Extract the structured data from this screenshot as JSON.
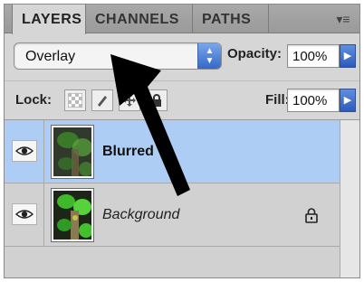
{
  "tabs": [
    {
      "label": "LAYERS",
      "active": true
    },
    {
      "label": "CHANNELS",
      "active": false
    },
    {
      "label": "PATHS",
      "active": false
    }
  ],
  "panel_menu_icon": "panel-menu-icon",
  "blend": {
    "value": "Overlay"
  },
  "opacity": {
    "label": "Opacity:",
    "value": "100%"
  },
  "lock": {
    "label": "Lock:"
  },
  "fill": {
    "label": "Fill:",
    "value": "100%"
  },
  "layers": [
    {
      "name": "Blurred",
      "selected": true,
      "visible": true
    },
    {
      "name": "Background",
      "selected": false,
      "visible": true,
      "locked": true
    }
  ],
  "colors": {
    "selection": "#aecdf4",
    "accent_blue": "#3568c8",
    "panel_bg": "#d6d6d6"
  }
}
